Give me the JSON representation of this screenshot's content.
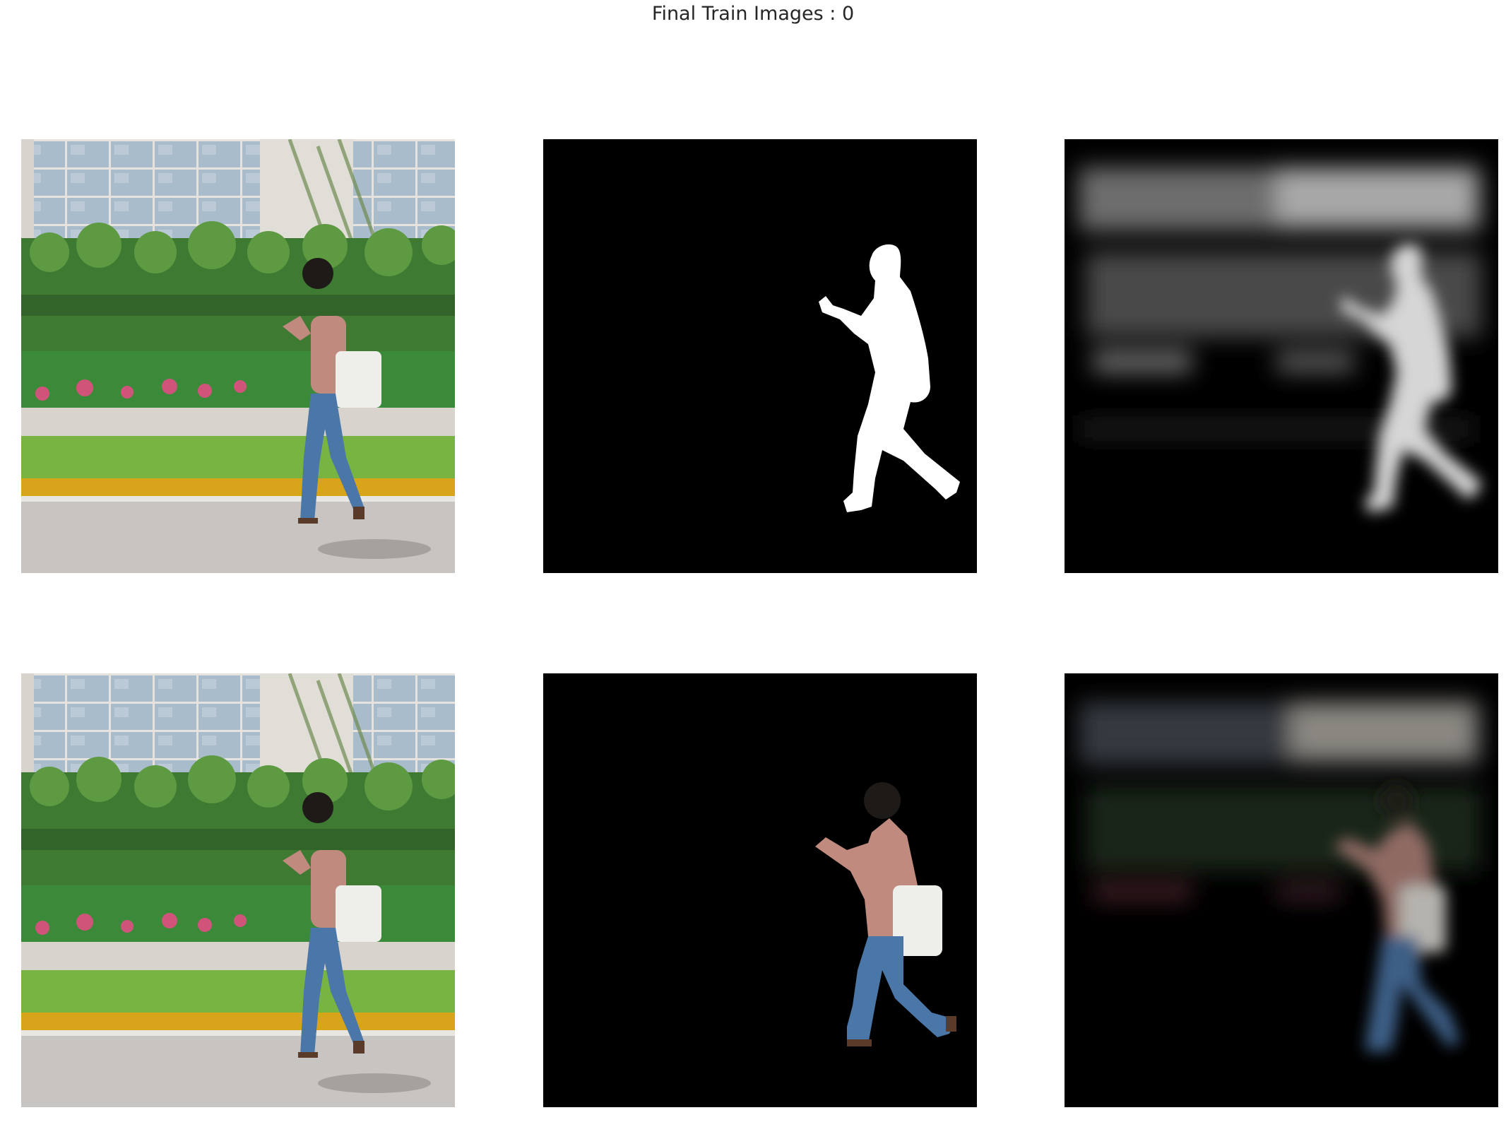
{
  "figure": {
    "title": "Final Train Images : 0"
  },
  "panels": {
    "row1": [
      "input-image",
      "ground-truth-mask",
      "predicted-mask"
    ],
    "row2": [
      "input-image",
      "masked-ground-truth",
      "masked-prediction"
    ]
  },
  "colors": {
    "background": "#ffffff",
    "mask_background": "#000000",
    "mask_foreground": "#ffffff",
    "sky_window": "#9fb3c2",
    "wall": "#d8d3cc",
    "hedge": "#3f7a33",
    "flowers": "#d0547a",
    "grass": "#78b442",
    "curb": "#d8a51a",
    "road": "#c7c4c1",
    "jeans": "#4b77a8",
    "shirt": "#c08a7e",
    "hair": "#1e1a18"
  }
}
